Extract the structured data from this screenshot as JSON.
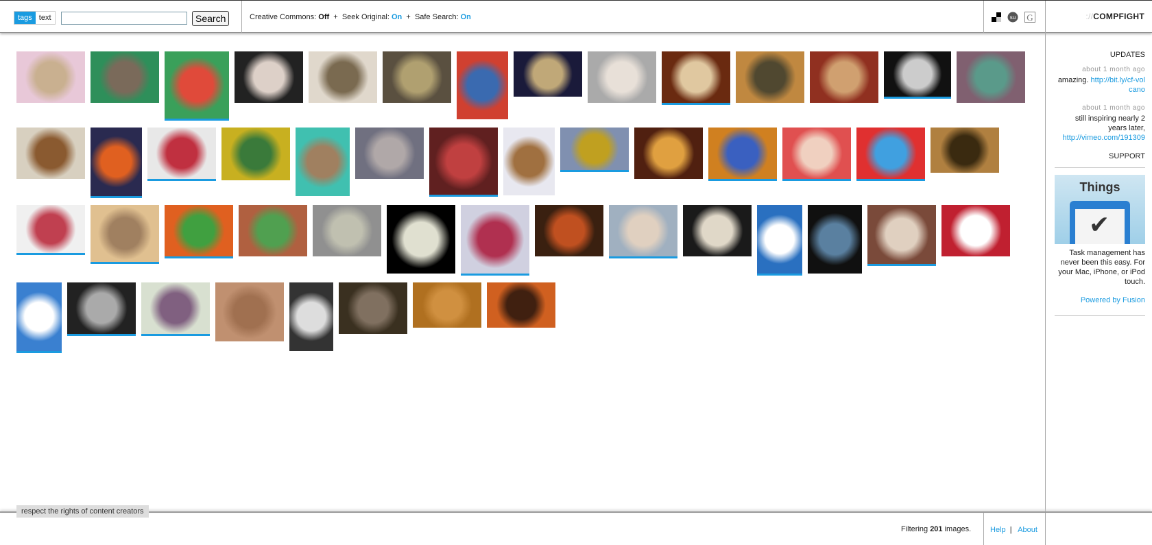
{
  "header": {
    "tabs": [
      {
        "label": "tags",
        "active": true
      },
      {
        "label": "text",
        "active": false
      }
    ],
    "search_value": "",
    "search_placeholder": "",
    "search_button": "Search",
    "filters": {
      "cc_label": "Creative Commons:",
      "cc_value": "Off",
      "sep": "+",
      "seek_label": "Seek Original:",
      "seek_value": "On",
      "safe_label": "Safe Search:",
      "safe_value": "On"
    },
    "icons": [
      "delicious-icon",
      "stumbleupon-icon",
      "google-icon"
    ],
    "logo_prefix": "://",
    "logo": "COMPFIGHT"
  },
  "colors": {
    "accent": "#1a9be0"
  },
  "thumbnails": [
    [
      "#e8c8d8",
      "#c9b090",
      false
    ],
    [
      "#2e8f5a",
      "#7a6a5a",
      false
    ],
    [
      "#3aa05a",
      "#e04a3a",
      true
    ],
    [
      "#222222",
      "#ddd0c8",
      false
    ],
    [
      "#e0d8cc",
      "#7a6a50",
      false
    ],
    [
      "#5a5040",
      "#b0a070",
      false
    ],
    [
      "#d04030",
      "#3a6ab0",
      false
    ],
    [
      "#1a1a3a",
      "#c0a878",
      false
    ],
    [
      "#aaaaaa",
      "#e8e0d8",
      false
    ],
    [
      "#6a2a10",
      "#e0c8a0",
      true
    ],
    [
      "#c08840",
      "#504830",
      false
    ],
    [
      "#903020",
      "#d0a070",
      false
    ],
    [
      "#111111",
      "#cccccc",
      true
    ],
    [
      "#806070",
      "#5a9a8a",
      false
    ],
    [
      "#d8d0c0",
      "#8a5a30",
      false
    ],
    [
      "#2a2a50",
      "#e06020",
      true
    ],
    [
      "#e8e8e8",
      "#c03040",
      true
    ],
    [
      "#c8b020",
      "#3a7a3a",
      false
    ],
    [
      "#40c0b0",
      "#a08060",
      false
    ],
    [
      "#707080",
      "#b0a8a8",
      false
    ],
    [
      "#602020",
      "#c04040",
      true
    ],
    [
      "#e8e8f0",
      "#a07040",
      false
    ],
    [
      "#8090b0",
      "#c0a020",
      true
    ],
    [
      "#502010",
      "#e0a040",
      false
    ],
    [
      "#d08020",
      "#3a60c0",
      true
    ],
    [
      "#e05050",
      "#f0d0c0",
      true
    ],
    [
      "#e03030",
      "#40a0e0",
      true
    ],
    [
      "#b08040",
      "#3a2a10",
      false
    ],
    [
      "#f0f0f0",
      "#c04050",
      true
    ],
    [
      "#e0c090",
      "#a08060",
      true
    ],
    [
      "#e06020",
      "#40a040",
      true
    ],
    [
      "#b06040",
      "#50a050",
      false
    ],
    [
      "#909090",
      "#c0c0b0",
      false
    ],
    [
      "#000000",
      "#e0e0d0",
      false
    ],
    [
      "#d0d0e0",
      "#b03050",
      true
    ],
    [
      "#3a2010",
      "#c05020",
      false
    ],
    [
      "#a0b0c0",
      "#e0d0c0",
      true
    ],
    [
      "#1a1a1a",
      "#e0d8c8",
      false
    ],
    [
      "#2a70c0",
      "#ffffff",
      true
    ],
    [
      "#101010",
      "#5a80a0",
      false
    ],
    [
      "#7a4a3a",
      "#e0d0c0",
      true
    ],
    [
      "#c02030",
      "#ffffff",
      false
    ],
    [
      "#3a80d0",
      "#ffffff",
      true
    ],
    [
      "#222222",
      "#aaaaaa",
      true
    ],
    [
      "#d8e0d0",
      "#806080",
      true
    ],
    [
      "#c09070",
      "#a07050",
      false
    ],
    [
      "#333333",
      "#dddddd",
      false
    ],
    [
      "#3a3020",
      "#807060",
      false
    ],
    [
      "#b07020",
      "#d09040",
      false
    ],
    [
      "#d06020",
      "#402010",
      false
    ]
  ],
  "sidebar": {
    "updates_title": "UPDATES",
    "updates": [
      {
        "time": "about 1 month ago",
        "text": "amazing. ",
        "link": "http://bit.ly/cf-volcano"
      },
      {
        "time": "about 1 month ago",
        "text": "still inspiring nearly 2 years later, ",
        "link": "http://vimeo.com/191309"
      }
    ],
    "support_title": "SUPPORT",
    "ad_title": "Things",
    "ad_text": "Task management has never been this easy. For your Mac, iPhone, or iPod touch.",
    "powered": "Powered by Fusion"
  },
  "footer": {
    "respect": "respect the rights of content creators",
    "filtering_pre": "Filtering ",
    "count": "201",
    "filtering_post": " images.",
    "help": "Help",
    "sep": "|",
    "about": "About"
  }
}
